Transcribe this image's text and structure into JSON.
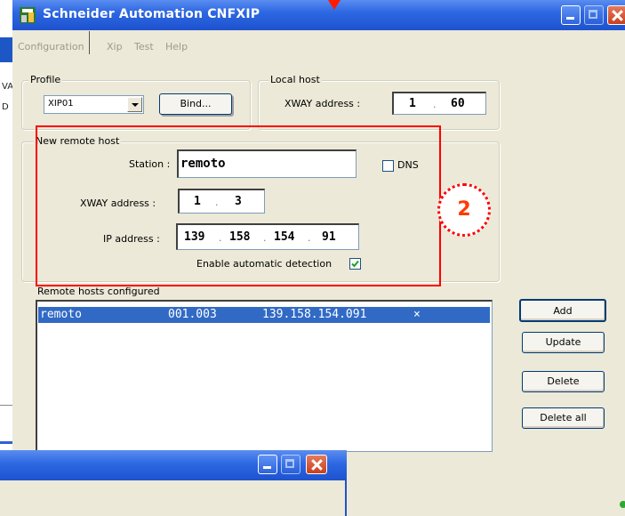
{
  "background": {
    "left_letters": [
      "VA",
      "D"
    ]
  },
  "window": {
    "title": "Schneider Automation CNFXIP",
    "colors": {
      "titlebar": "#2d67e2",
      "selection": "#316ac5",
      "highlight": "#ff0000"
    }
  },
  "menu": {
    "items": [
      "Configuration",
      "Xip",
      "Test",
      "Help"
    ]
  },
  "profile": {
    "legend": "Profile",
    "selected": "XIP01",
    "bind_label": "Bind..."
  },
  "local_host": {
    "legend": "Local host",
    "xway_label": "XWAY address :",
    "xway_network": "1",
    "xway_station": "60"
  },
  "new_remote_host": {
    "legend": "New remote host",
    "station_label": "Station :",
    "station_value": "remoto",
    "dns_label": "DNS",
    "dns_checked": false,
    "xway_label": "XWAY address :",
    "xway_network": "1",
    "xway_station": "3",
    "ip_label": "IP address :",
    "ip_octets": [
      "139",
      "158",
      "154",
      "91"
    ],
    "auto_detect_label": "Enable automatic detection",
    "auto_detect_checked": true
  },
  "remote_hosts": {
    "legend": "Remote hosts configured",
    "rows": [
      {
        "name": "remoto",
        "xway": "001.003",
        "ip": "139.158.154.091",
        "flag": "×"
      }
    ]
  },
  "buttons": {
    "add": "Add",
    "update": "Update",
    "delete": "Delete",
    "delete_all": "Delete all"
  },
  "annotation": {
    "step_number": "2"
  }
}
